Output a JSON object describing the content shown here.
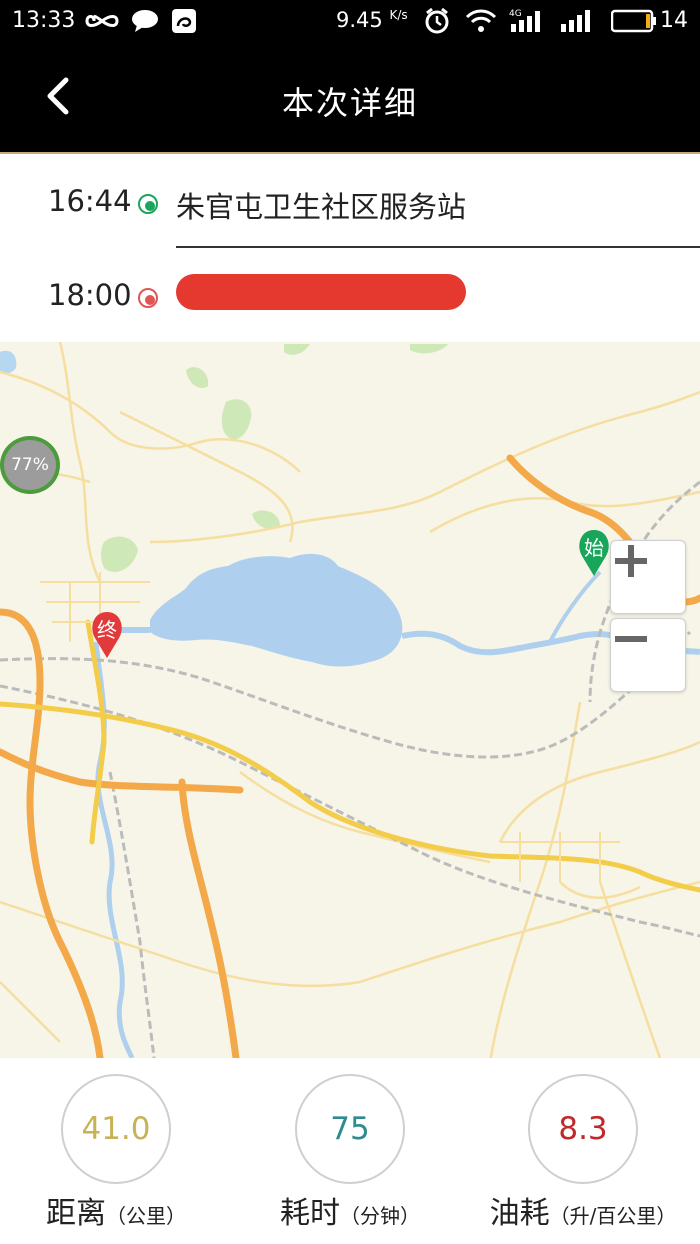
{
  "status_bar": {
    "time": "13:33",
    "speed_value": "9.45",
    "speed_unit": "K/s",
    "network": "4G",
    "battery": "14",
    "icons": [
      "infinity-icon",
      "chat-bubble-icon",
      "uc-browser-icon",
      "alarm-icon",
      "wifi-icon",
      "signal-icon",
      "battery-icon"
    ]
  },
  "header": {
    "title": "本次详细",
    "back_icon": "chevron-left-icon"
  },
  "route": {
    "start": {
      "time": "16:44",
      "place": "朱官屯卫生社区服务站",
      "color": "#1aa65a"
    },
    "end": {
      "time": "18:00",
      "place": "",
      "color": "#e25555"
    }
  },
  "map": {
    "battery_bubble": "77%",
    "start_marker": "始",
    "end_marker": "终",
    "zoom_in": "+",
    "zoom_out": "−"
  },
  "stats": [
    {
      "value": "41.0",
      "label": "距离",
      "unit": "（公里）",
      "color": "#c8b255"
    },
    {
      "value": "75",
      "label": "耗时",
      "unit": "（分钟）",
      "color": "#2d8c8f"
    },
    {
      "value": "8.3",
      "label": "油耗",
      "unit": "（升/百公里）",
      "color": "#c0282a"
    }
  ]
}
